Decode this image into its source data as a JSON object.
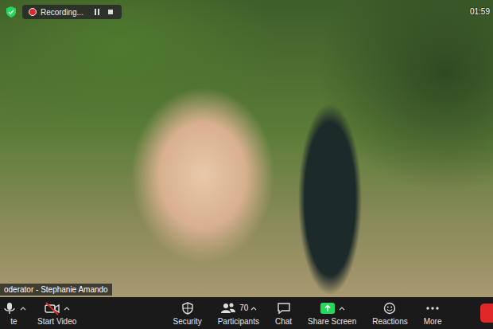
{
  "meeting": {
    "recording": {
      "label": "Recording...",
      "paused": false
    },
    "clock": "01:59",
    "participant_name": "oderator - Stephanie Amando"
  },
  "toolbar": {
    "items": [
      {
        "label": "te",
        "kind": "mic",
        "menu": true,
        "off": false
      },
      {
        "label": "Start Video",
        "kind": "video",
        "menu": true,
        "off": true
      },
      {
        "label": "Security",
        "kind": "security",
        "menu": false,
        "off": false
      },
      {
        "label": "Participants",
        "kind": "participants",
        "menu": true,
        "off": false,
        "count": "70"
      },
      {
        "label": "Chat",
        "kind": "chat",
        "menu": false,
        "off": false
      },
      {
        "label": "Share Screen",
        "kind": "share",
        "menu": true,
        "off": false
      },
      {
        "label": "Reactions",
        "kind": "reactions",
        "menu": false,
        "off": false
      },
      {
        "label": "More",
        "kind": "more",
        "menu": false,
        "off": false
      }
    ]
  }
}
